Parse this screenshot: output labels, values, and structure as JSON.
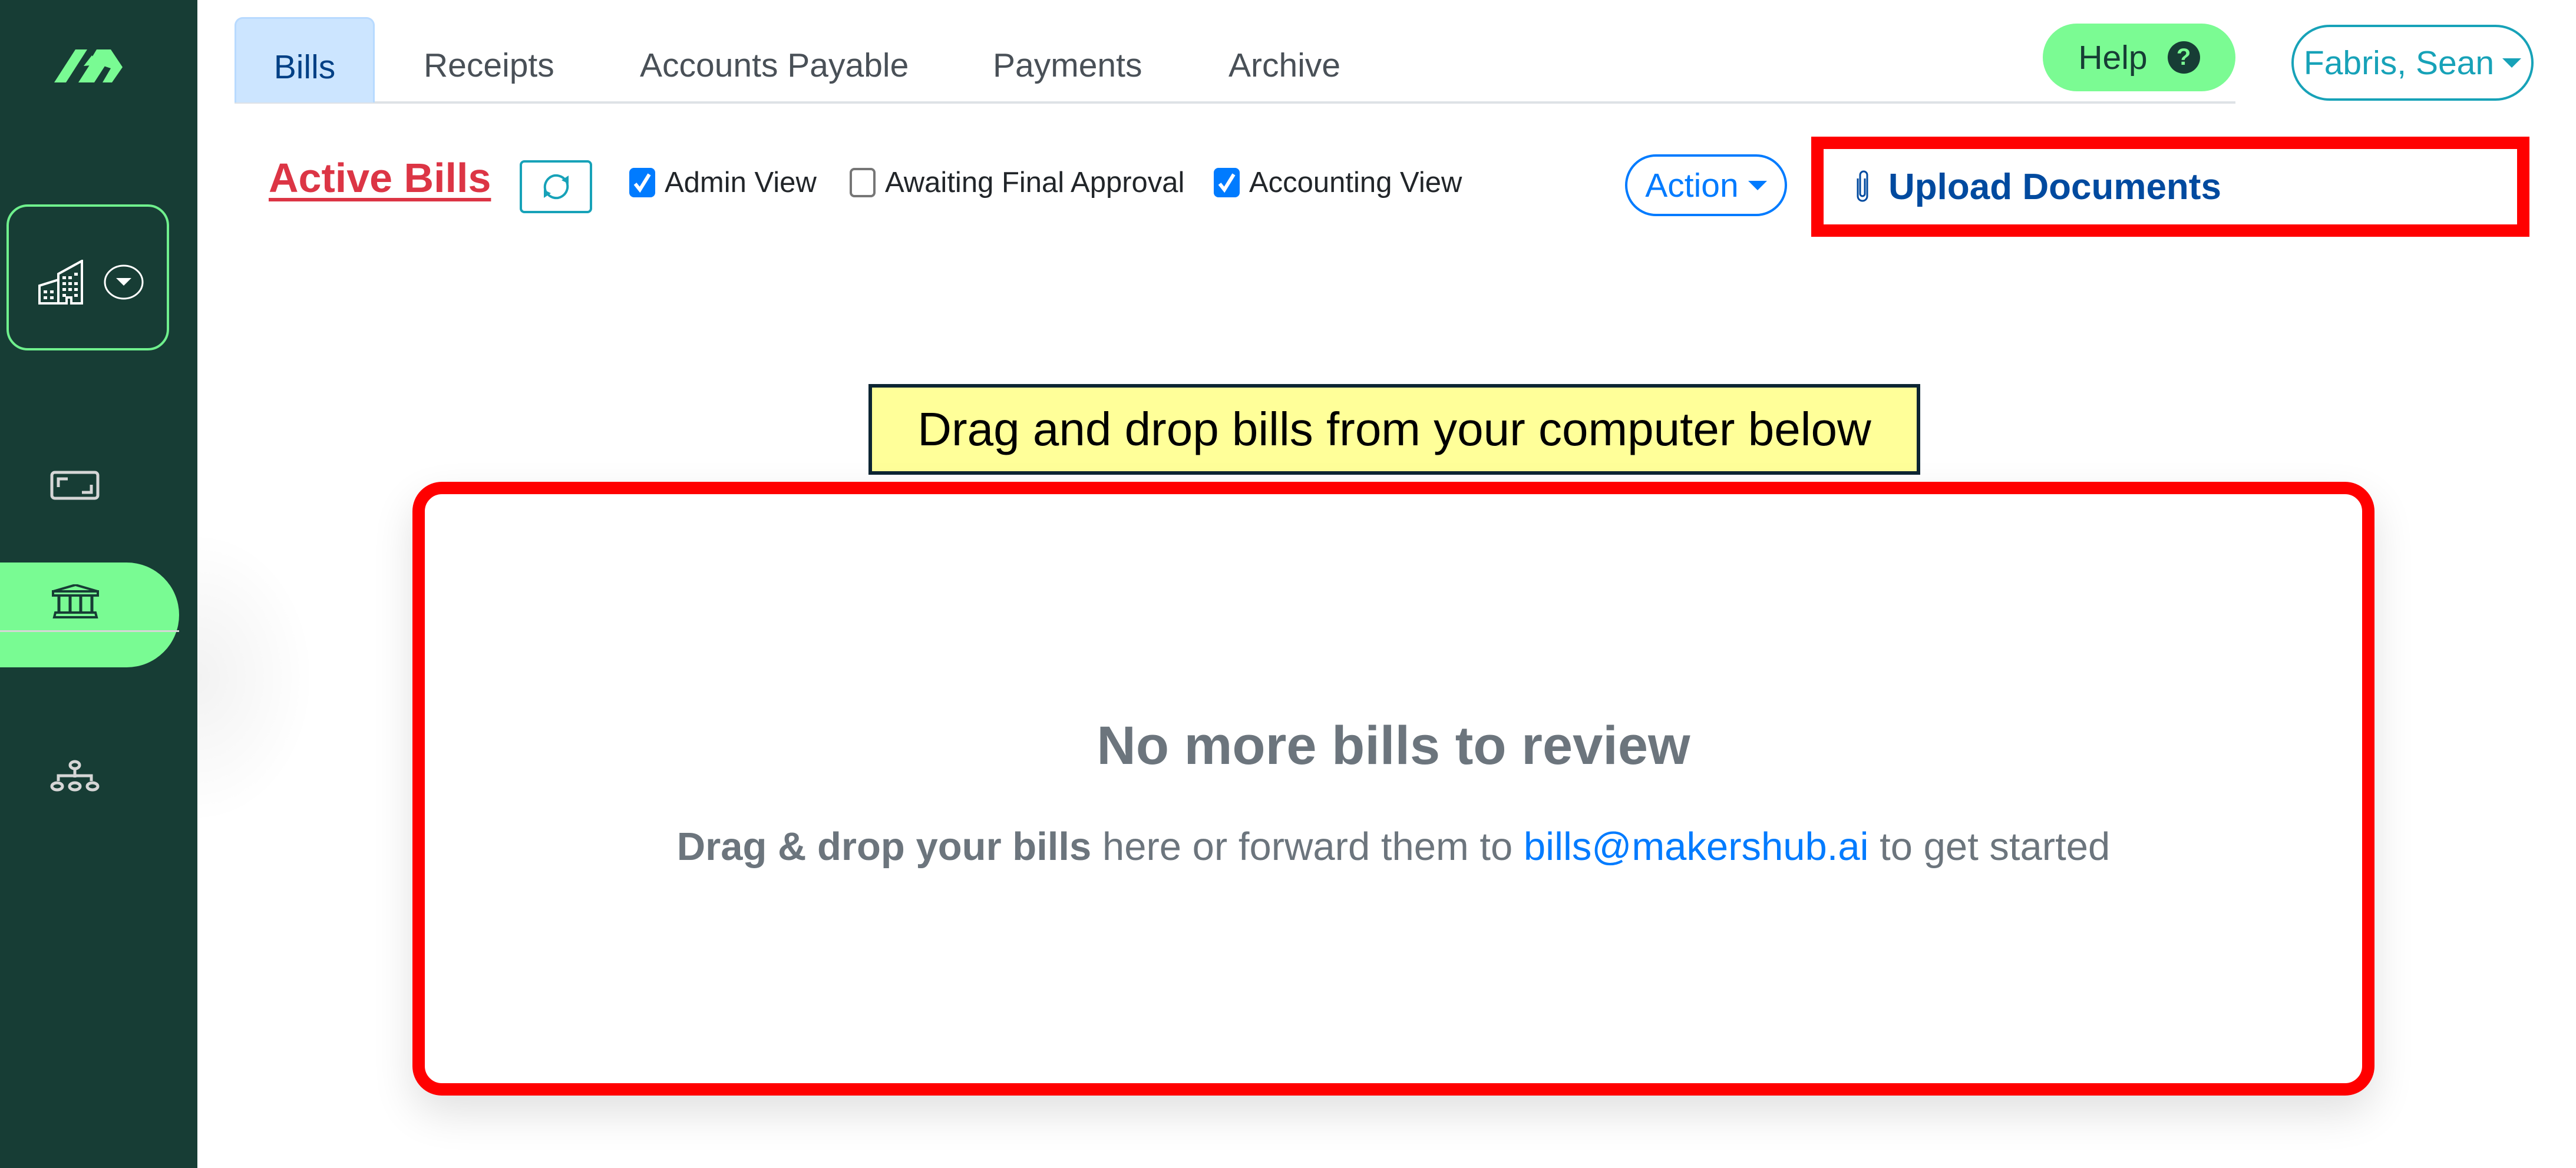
{
  "sidebar": {
    "logo": "makershub-logo",
    "org_selector": {
      "icon": "building-icon",
      "dropdown_icon": "chevron-down-circle-icon"
    },
    "nav_items": [
      {
        "name": "scan",
        "icon": "scan-frame-icon",
        "active": false
      },
      {
        "name": "bank",
        "icon": "bank-icon",
        "active": true
      },
      {
        "name": "hierarchy",
        "icon": "sitemap-icon",
        "active": false
      }
    ]
  },
  "tabs": [
    {
      "label": "Bills",
      "active": true
    },
    {
      "label": "Receipts",
      "active": false
    },
    {
      "label": "Accounts Payable",
      "active": false
    },
    {
      "label": "Payments",
      "active": false
    },
    {
      "label": "Archive",
      "active": false
    }
  ],
  "header": {
    "help_label": "Help",
    "help_icon": "?",
    "user_name": "Fabris, Sean"
  },
  "toolbar": {
    "title": "Active Bills",
    "refresh_icon": "refresh-icon",
    "checkboxes": [
      {
        "label": "Admin View",
        "checked": true
      },
      {
        "label": "Awaiting Final Approval",
        "checked": false
      },
      {
        "label": "Accounting View",
        "checked": true
      }
    ],
    "action_label": "Action",
    "upload_label": "Upload Documents"
  },
  "drop_area": {
    "hint": "Drag and drop bills from your computer below",
    "empty_title": "No more bills to review",
    "sub_bold": "Drag & drop your bills",
    "sub_mid": " here or forward them to ",
    "email": "bills@makershub.ai",
    "sub_end": " to get started"
  },
  "colors": {
    "sidebar_bg": "#173d35",
    "brand_green": "#7bfb93",
    "highlight_red": "#ff0000",
    "title_red": "#dc3545",
    "primary_blue": "#007bff",
    "upload_blue": "#004a9f",
    "teal": "#17a2b8",
    "hint_yellow": "#ffff99"
  }
}
